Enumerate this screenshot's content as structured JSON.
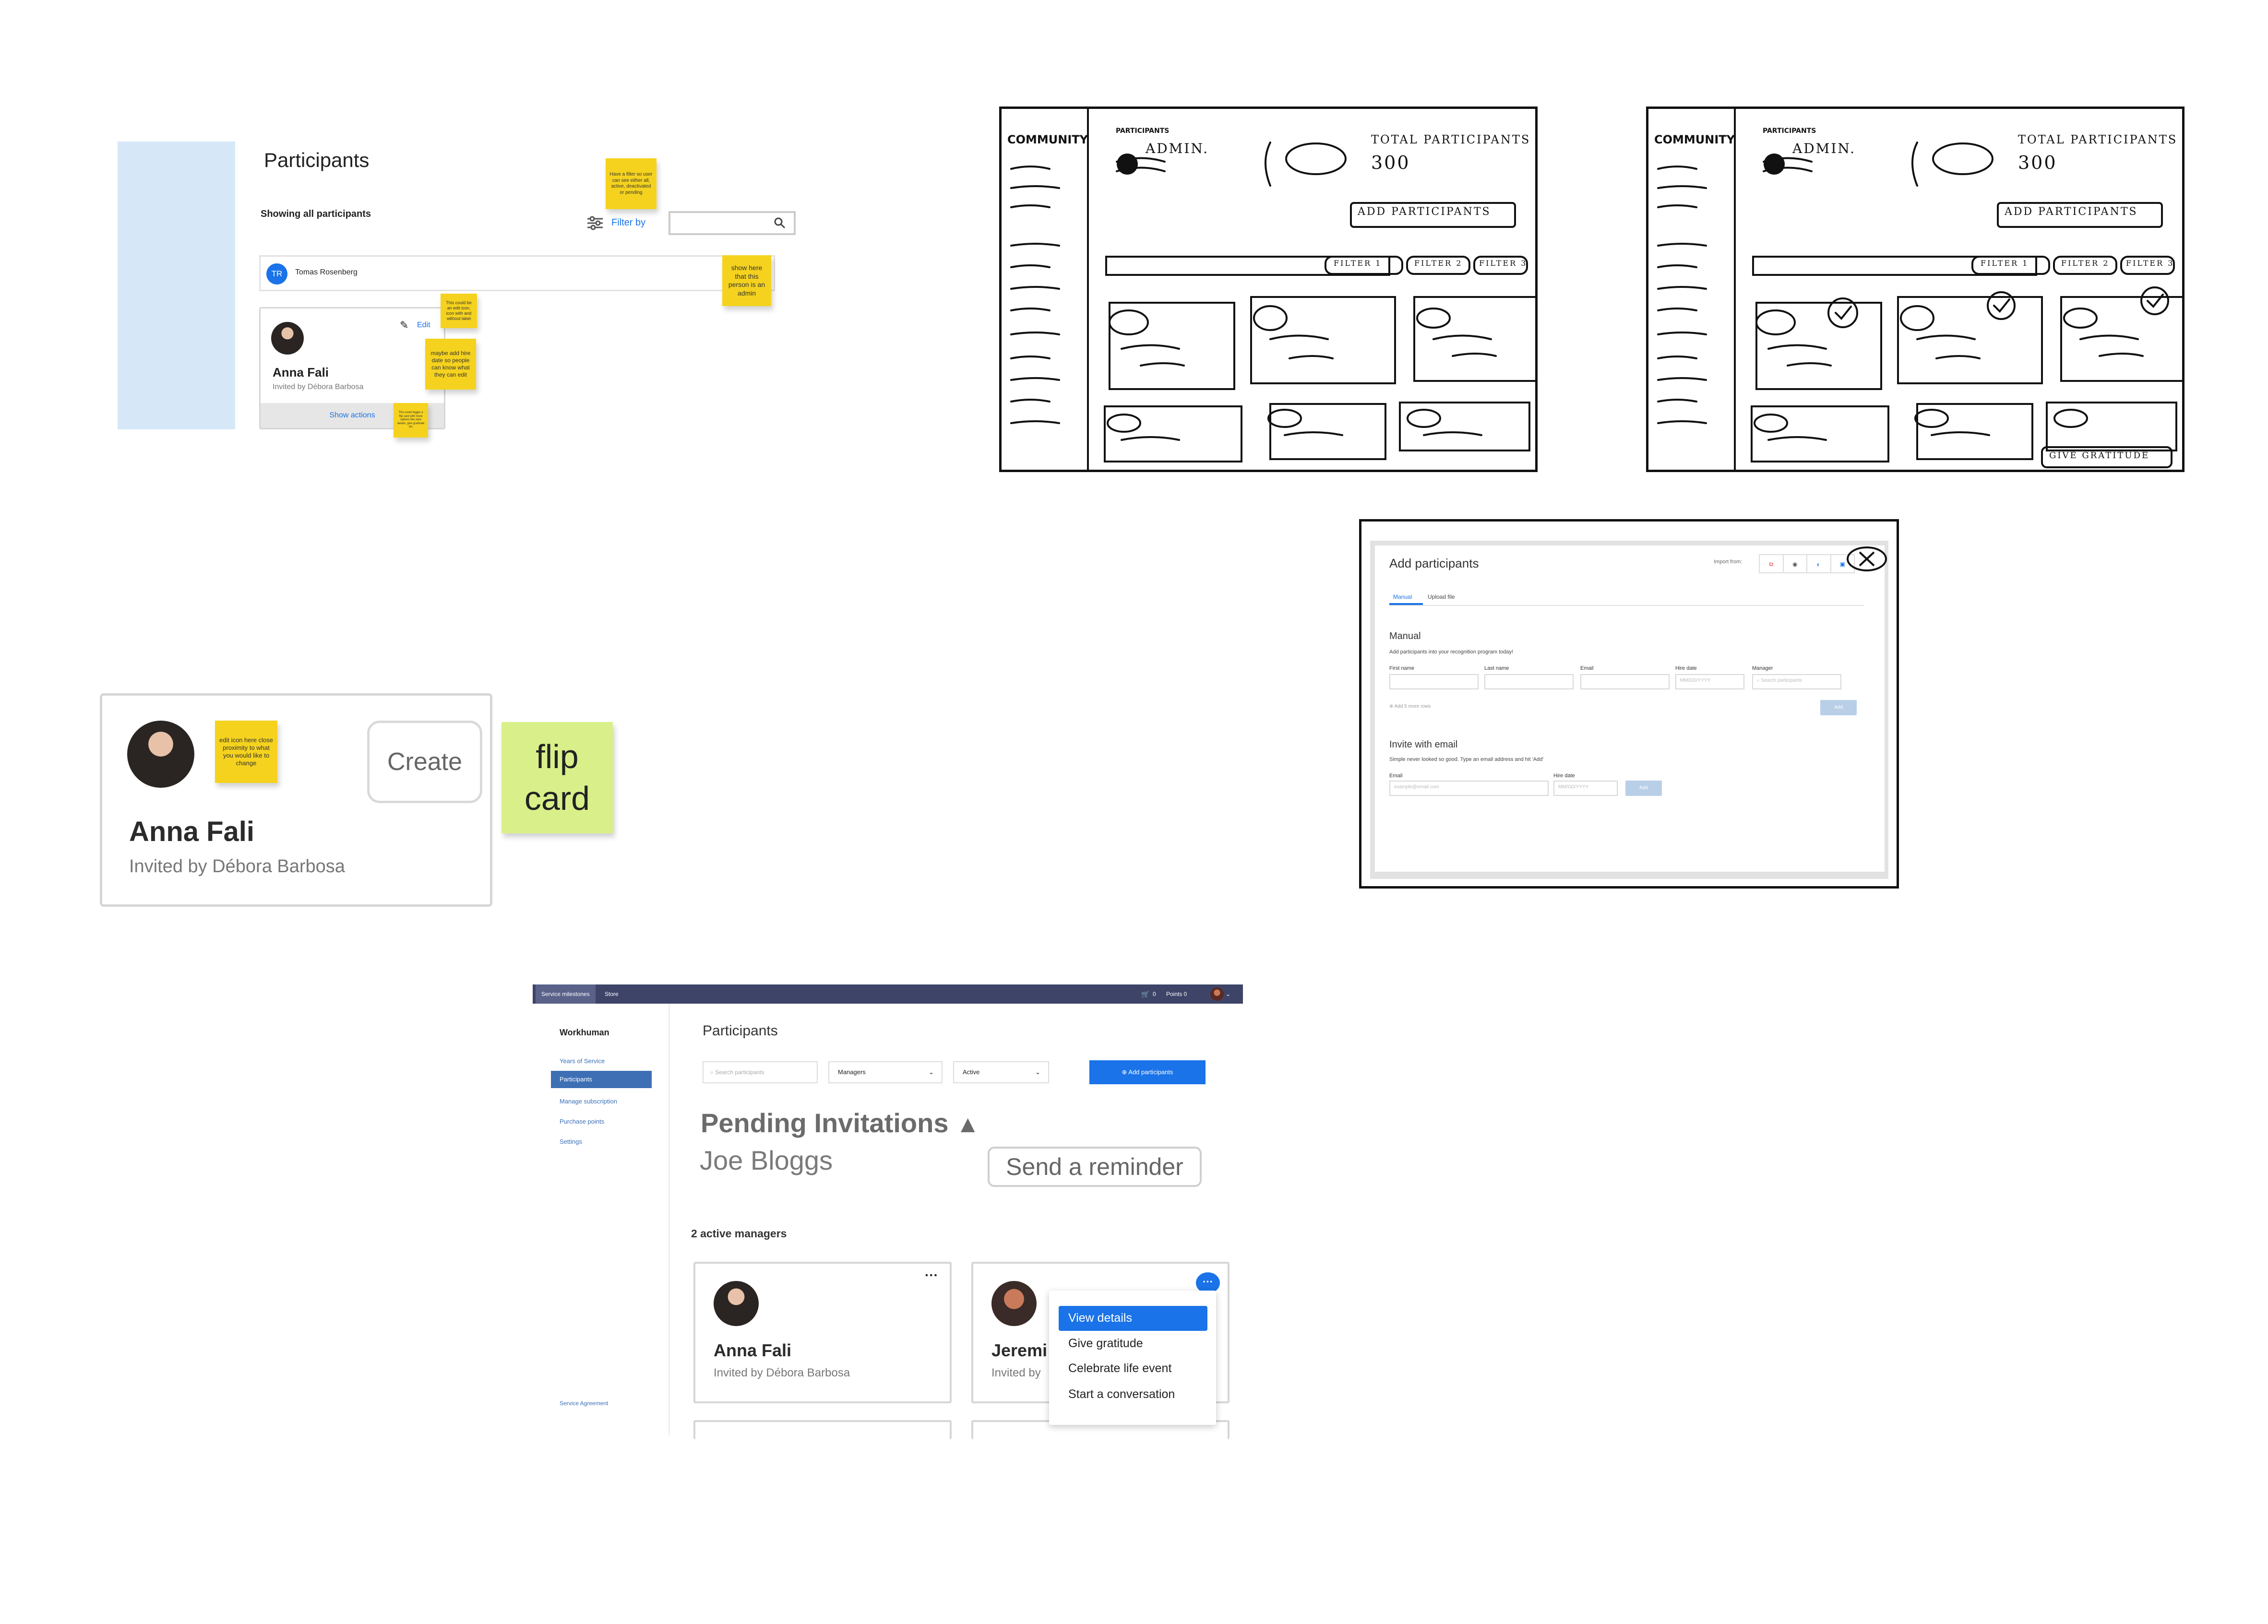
{
  "wire1": {
    "title": "Participants",
    "subtitle": "Showing all participants",
    "filter_label": "Filter by",
    "user_initials": "TR",
    "user_name": "Tomas Rosenberg",
    "card_name": "Anna Fali",
    "card_invited": "Invited by Débora Barbosa",
    "edit_label": "Edit",
    "show_actions": "Show actions",
    "notes": {
      "filter_note": "Have a filter so user can see either all, active, deactivated or pending",
      "admin_note": "show here that this person is an admin",
      "edit_note": "This could be an edit icon, icon with and without label",
      "hire_note": "maybe add hire date so people can know what they can edit",
      "actions_note": "This could trigger a flip card with more options like view details, give gratitude etc"
    }
  },
  "sketches": {
    "community": "COMMUNITY",
    "participants": "PARTICIPANTS",
    "admin": "ADMIN.",
    "total": "TOTAL PARTICIPANTS",
    "total_value": "300",
    "add_participants": "ADD PARTICIPANTS",
    "filter1": "FILTER 1",
    "filter2": "FILTER 2",
    "filter3": "FILTER 3",
    "give_gratitude": "GIVE GRATITUDE"
  },
  "card_zoom": {
    "name": "Anna Fali",
    "invited": "Invited by Débora Barbosa",
    "create_label": "Create",
    "edit_note": "edit icon here close proximity to what you would like to change",
    "flip_note": "flip card"
  },
  "add_modal": {
    "title": "Add participants",
    "import_from": "Import from:",
    "tabs": [
      "Manual",
      "Upload file"
    ],
    "manual_heading": "Manual",
    "manual_desc": "Add participants into your recognition program today!",
    "fields": [
      "First name",
      "Last name",
      "Email",
      "Hire date",
      "Manager"
    ],
    "date_placeholder": "MM/DD/YYYY",
    "manager_placeholder": "Search participants",
    "add_more_rows": "Add 5 more rows",
    "add_btn": "Add",
    "invite_heading": "Invite with email",
    "invite_desc": "Simple never looked so good. Type an email address and hit 'Add'",
    "invite_email_label": "Email",
    "invite_hire_label": "Hire date",
    "email_placeholder": "example@email.com"
  },
  "app": {
    "topbar": {
      "service_milestones": "Service milestones",
      "store": "Store",
      "cart_count": "0",
      "points": "Points 0"
    },
    "sidebar": {
      "brand": "Workhuman",
      "items": [
        "Years of Service",
        "Participants",
        "Manage subscription",
        "Purchase points",
        "Settings"
      ],
      "footer": "Service Agreement"
    },
    "page_title": "Participants",
    "search_placeholder": "Search participants",
    "filter_managers": "Managers",
    "filter_active": "Active",
    "add_button": "Add participants",
    "pending_heading": "Pending Invitations",
    "pending_name": "Joe Bloggs",
    "send_reminder": "Send a reminder",
    "active_count": "2 active managers",
    "card1": {
      "name": "Anna Fali",
      "invited": "Invited by Débora Barbosa"
    },
    "card2": {
      "name": "Jeremi",
      "invited": "Invited by"
    },
    "dropdown": [
      "View details",
      "Give gratitude",
      "Celebrate life event",
      "Start a conversation"
    ]
  },
  "colors": {
    "accent": "#1a73e8",
    "sidebar_active": "#3e6fb4",
    "topbar": "#3d4468",
    "sticky_yellow": "#f5d21e",
    "sticky_green": "#d9f08a",
    "wire_blue": "#d6e8f8"
  }
}
